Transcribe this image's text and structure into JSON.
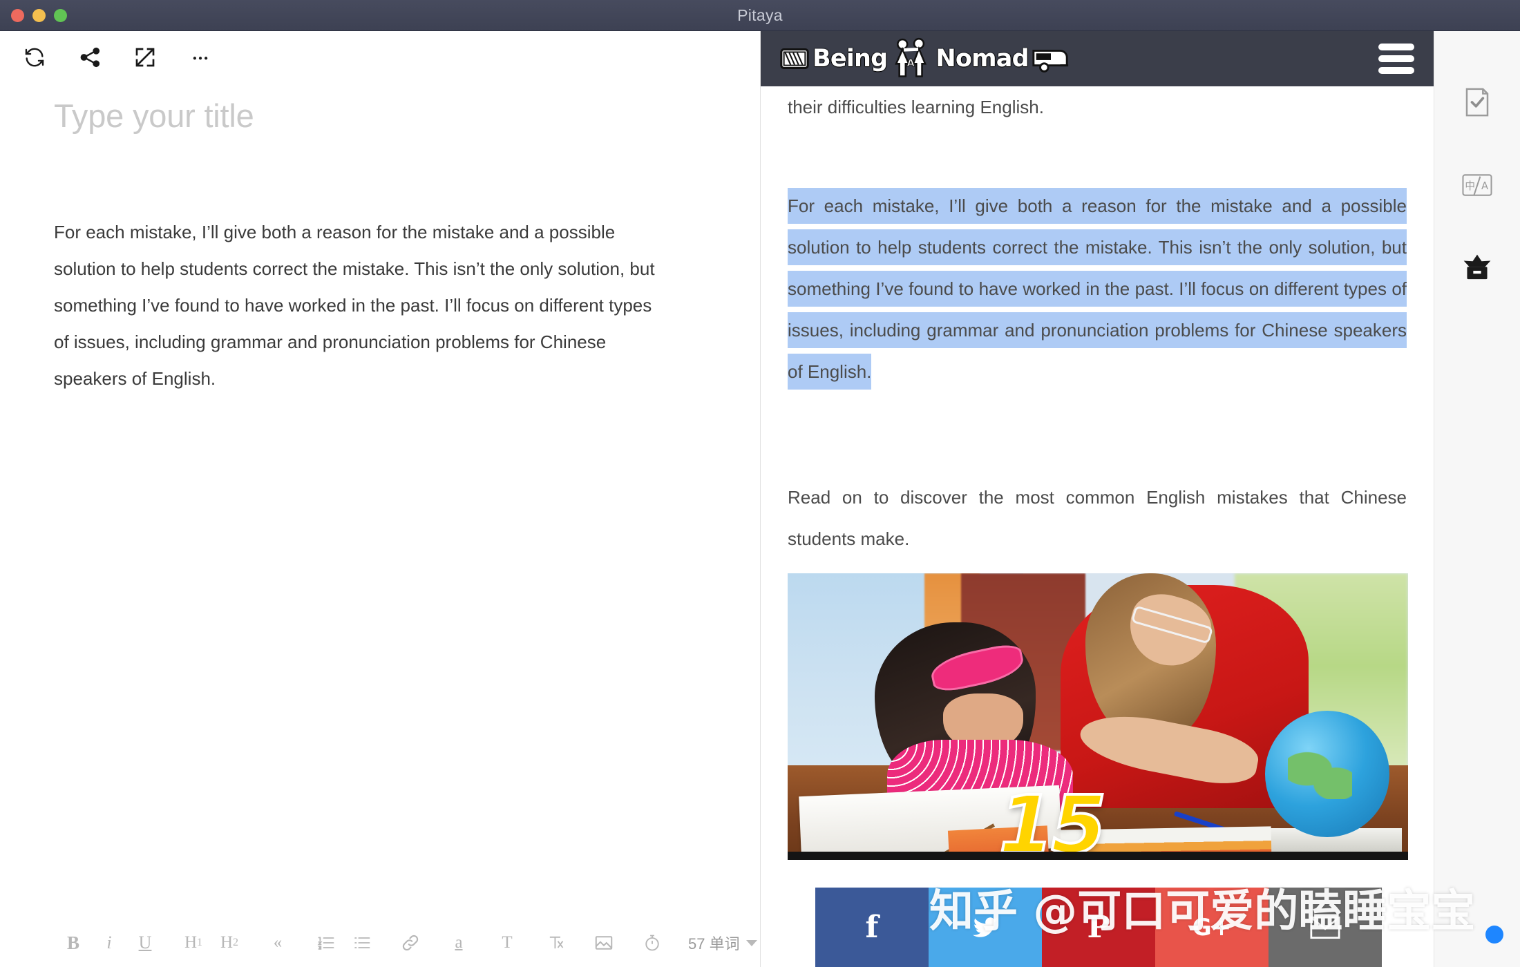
{
  "window": {
    "title": "Pitaya",
    "traffic_lights": [
      "close",
      "minimize",
      "maximize"
    ]
  },
  "editor": {
    "toolbar_top": [
      {
        "name": "sync-icon",
        "label": "Sync"
      },
      {
        "name": "share-icon",
        "label": "Share"
      },
      {
        "name": "fullscreen-icon",
        "label": "Fullscreen"
      },
      {
        "name": "more-icon",
        "label": "More"
      }
    ],
    "title_placeholder": "Type your title",
    "body_text": "For each mistake, I’ll give both a reason for the mistake and a possible solution to help students correct the mistake. This isn’t the only solution, but something I’ve found to have worked in the past. I’ll focus on different types of issues, including grammar and pronunciation problems for Chinese speakers of English.",
    "toolbar_bottom": {
      "bold": "B",
      "italic": "i",
      "underline": "U",
      "heading1": "H",
      "heading1_sub": "1",
      "heading2": "H",
      "heading2_sub": "2",
      "quote": "«",
      "ordered_list": "ordered-list-icon",
      "unordered_list": "unordered-list-icon",
      "link": "link-icon",
      "highlight": "a",
      "text_style": "T",
      "clear_format": "clear-format-icon",
      "image": "image-icon",
      "timer": "timer-icon",
      "word_count": "57 单词"
    }
  },
  "preview": {
    "site_header": {
      "logo_text_1": "Being",
      "logo_text_2": "Nomad",
      "logo_letter": "A",
      "menu": "hamburger-menu-icon"
    },
    "paragraphs": [
      {
        "id": "p1",
        "text": "…to Chinese students. But students can use it as well to help them overcome their difficulties learning English.",
        "selected": false
      },
      {
        "id": "p2",
        "text": "For each mistake, I’ll give both a reason for the mistake and a possible solution to help students correct the mistake. This isn’t the only solution, but something I’ve found to have worked in the past. I’ll focus on different types of issues, including grammar and pronunciation problems for Chinese speakers of English.",
        "selected": true
      },
      {
        "id": "p3",
        "text": "Read on to discover the most common English mistakes that Chinese students make.",
        "selected": false
      }
    ],
    "figure": {
      "name": "tutoring-photo",
      "overlay_number": "15",
      "alt": "A teacher in a red shirt helping a young girl with her schoolwork at a desk with a globe and notebooks"
    },
    "social_buttons": [
      {
        "name": "facebook-share-button",
        "glyph": "f",
        "color": "#3b5998"
      },
      {
        "name": "twitter-share-button",
        "glyph": "twitter-icon",
        "color": "#4aa9ea"
      },
      {
        "name": "pinterest-share-button",
        "glyph": "P",
        "color": "#c21f26"
      },
      {
        "name": "googleplus-share-button",
        "glyph": "G+",
        "color": "#e8544a"
      },
      {
        "name": "email-share-button",
        "glyph": "envelope-icon",
        "color": "#6b6b6b"
      }
    ],
    "watermark": "知乎 @可口可爱的瞌睡宝宝"
  },
  "right_sidebar": {
    "items": [
      {
        "name": "proofread-icon",
        "label": "Proofread"
      },
      {
        "name": "translate-icon",
        "label": "Translate",
        "glyph": "中/A"
      },
      {
        "name": "archive-icon",
        "label": "Archive"
      }
    ]
  },
  "colors": {
    "titlebar": "#3d4153",
    "selection": "#aecbf5",
    "site_header": "#3b3e4a",
    "sidebar_bg": "#f7f7f7"
  }
}
